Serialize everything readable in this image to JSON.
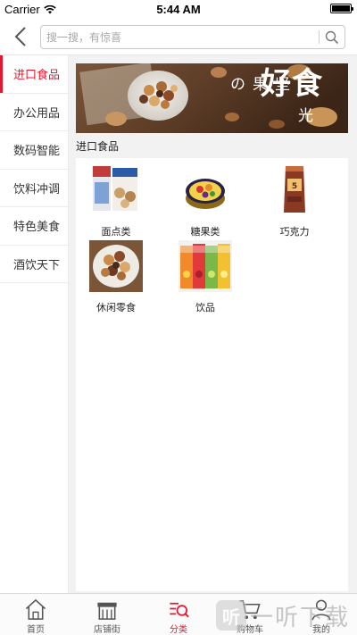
{
  "status_bar": {
    "carrier": "Carrier",
    "time": "5:44 AM",
    "battery_level": 1.0
  },
  "header": {
    "back_icon": "back-arrow-icon",
    "search": {
      "placeholder": "搜一搜，有惊喜",
      "value": "",
      "button_icon": "search-icon"
    }
  },
  "sidebar": {
    "active_index": 0,
    "items": [
      {
        "label": "进口食品"
      },
      {
        "label": "办公用品"
      },
      {
        "label": "数码智能"
      },
      {
        "label": "饮料冲调"
      },
      {
        "label": "特色美食"
      },
      {
        "label": "酒饮天下"
      }
    ]
  },
  "content": {
    "banner": {
      "text_big": "好食",
      "text_vertical": "坚果の",
      "text_tail": "光"
    },
    "section_title": "进口食品",
    "products": [
      {
        "name": "面点类",
        "icon": "cookie-box-icon"
      },
      {
        "name": "糖果类",
        "icon": "candy-tin-icon"
      },
      {
        "name": "巧克力",
        "icon": "chocolate-bar-icon"
      },
      {
        "name": "休闲零食",
        "icon": "mixed-nuts-icon"
      },
      {
        "name": "饮品",
        "icon": "juice-cartons-icon"
      }
    ]
  },
  "tabbar": {
    "active_index": 2,
    "tabs": [
      {
        "label": "首页",
        "icon": "home-icon"
      },
      {
        "label": "店铺街",
        "icon": "store-icon"
      },
      {
        "label": "分类",
        "icon": "category-search-icon"
      },
      {
        "label": "购物车",
        "icon": "cart-icon"
      },
      {
        "label": "我的",
        "icon": "user-icon"
      }
    ]
  },
  "watermark": {
    "logo": "听",
    "text": "一听下载"
  },
  "colors": {
    "accent": "#e5162f",
    "background": "#f2f2f2",
    "divider": "#ececec"
  }
}
